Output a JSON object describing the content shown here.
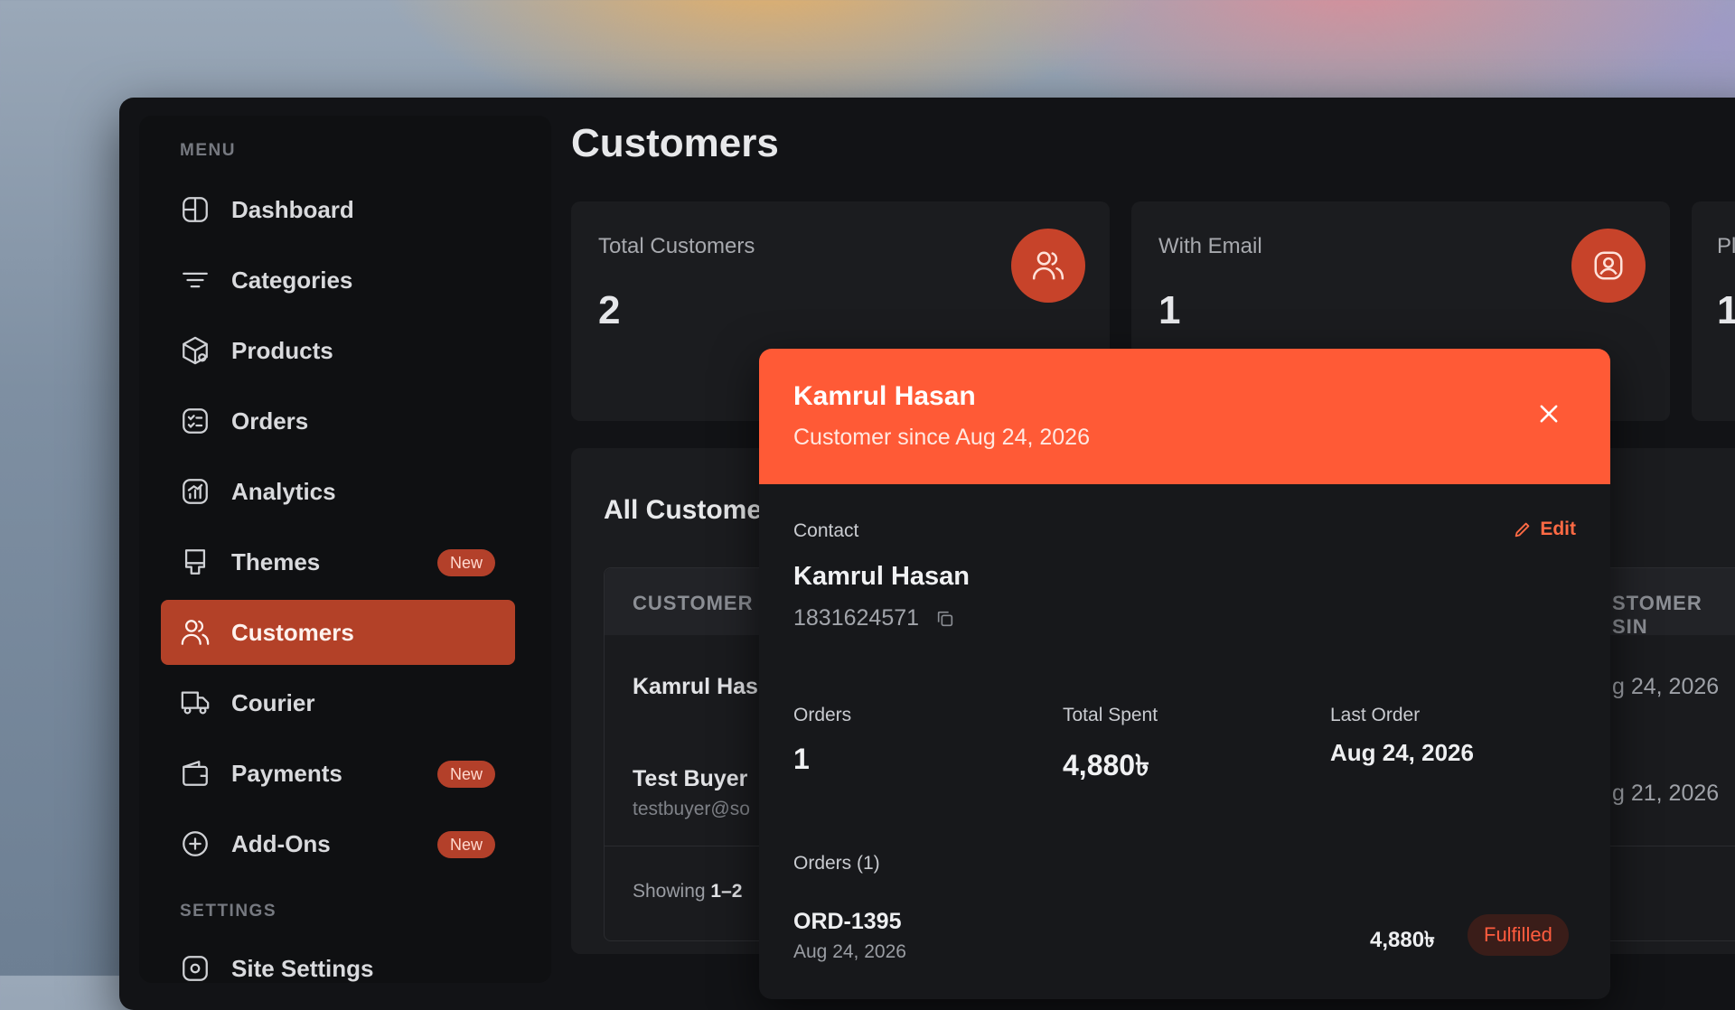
{
  "sidebar": {
    "menu_label": "MENU",
    "settings_label": "SETTINGS",
    "items": [
      {
        "label": "Dashboard"
      },
      {
        "label": "Categories"
      },
      {
        "label": "Products"
      },
      {
        "label": "Orders"
      },
      {
        "label": "Analytics"
      },
      {
        "label": "Themes",
        "badge": "New"
      },
      {
        "label": "Customers",
        "active": true
      },
      {
        "label": "Courier"
      },
      {
        "label": "Payments",
        "badge": "New"
      },
      {
        "label": "Add-Ons",
        "badge": "New"
      }
    ],
    "settings_items": [
      {
        "label": "Site Settings"
      }
    ]
  },
  "page": {
    "title": "Customers"
  },
  "stats": [
    {
      "label": "Total Customers",
      "value": "2",
      "icon": "users-icon"
    },
    {
      "label": "With Email",
      "value": "1",
      "icon": "user-circle-icon"
    },
    {
      "label": "Pl",
      "value": "1"
    }
  ],
  "table": {
    "title": "All Custome",
    "headers": {
      "customer": "CUSTOMER",
      "since": "STOMER SIN"
    },
    "rows": [
      {
        "name": "Kamrul Has",
        "email": "",
        "since": "g 24, 2026"
      },
      {
        "name": "Test Buyer",
        "email": "testbuyer@so",
        "since": "g 21, 2026"
      }
    ],
    "showing_prefix": "Showing",
    "showing_range": "1–2"
  },
  "modal": {
    "name": "Kamrul Hasan",
    "since": "Customer since Aug 24, 2026",
    "contact_label": "Contact",
    "edit_label": "Edit",
    "contact_name": "Kamrul Hasan",
    "phone": "1831624571",
    "orders_label": "Orders",
    "orders_value": "1",
    "spent_label": "Total Spent",
    "spent_value": "4,880৳",
    "last_order_label": "Last Order",
    "last_order_value": "Aug 24, 2026",
    "orders_list_label": "Orders (1)",
    "orders": [
      {
        "id": "ORD-1395",
        "date": "Aug 24, 2026",
        "amount": "4,880৳",
        "status": "Fulfilled"
      }
    ]
  },
  "colors": {
    "accent": "#ff5a36",
    "active_nav": "#b34128",
    "badge": "#b3402a",
    "status_fulfilled": "#ff5c3e"
  }
}
